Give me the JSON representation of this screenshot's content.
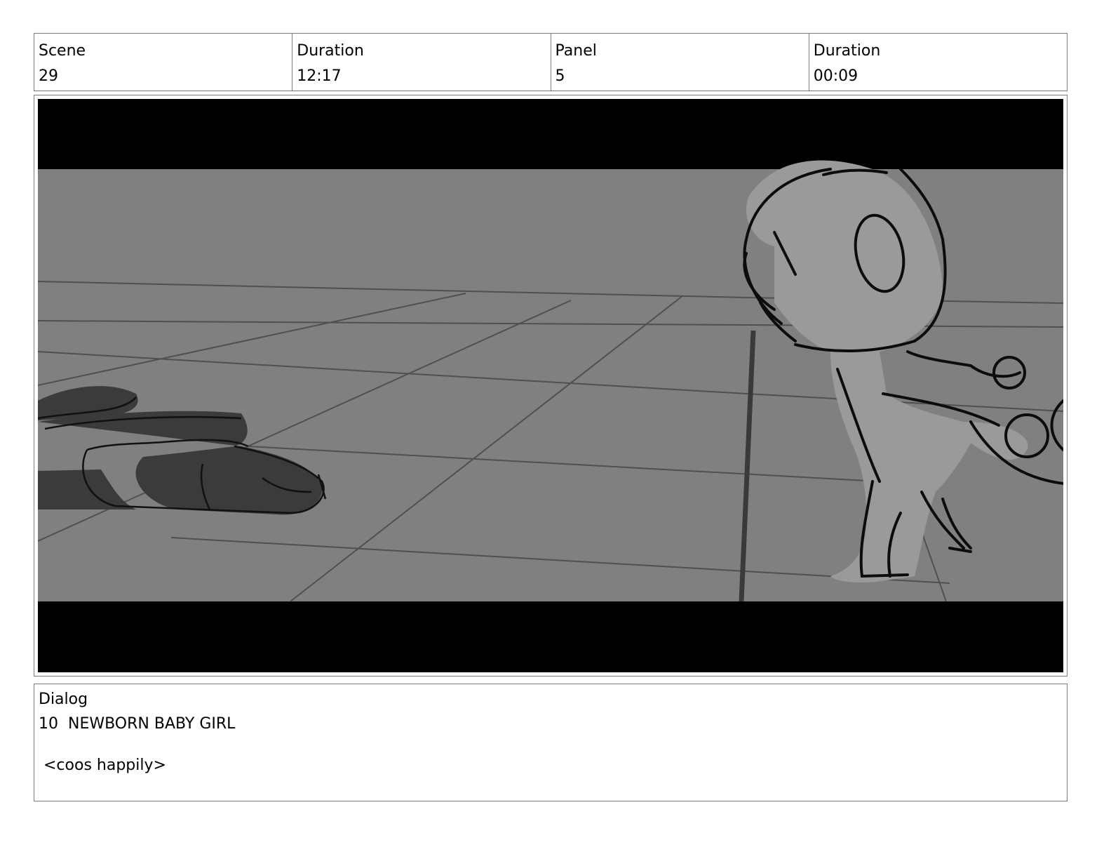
{
  "header": {
    "scene_label": "Scene",
    "scene_value": "29",
    "scene_duration_label": "Duration",
    "scene_duration_value": "12:17",
    "panel_label": "Panel",
    "panel_value": "5",
    "panel_duration_label": "Duration",
    "panel_duration_value": "00:09"
  },
  "dialog": {
    "label": "Dialog",
    "speaker": "10  NEWBORN BABY GIRL",
    "line": " <coos happily>"
  }
}
